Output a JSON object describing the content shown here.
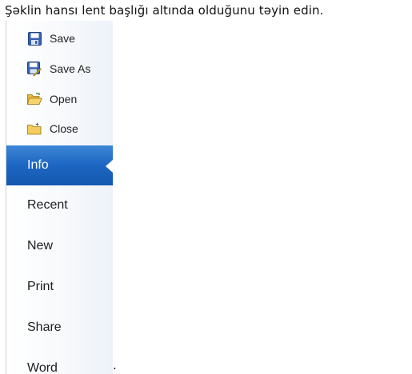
{
  "question": "Şəklin hansı lent başlığı altında olduğunu təyin edin.",
  "menu": {
    "commands": [
      {
        "label": "Save",
        "icon": "floppy-disk-icon"
      },
      {
        "label": "Save As",
        "icon": "save-as-icon"
      },
      {
        "label": "Open",
        "icon": "open-folder-icon"
      },
      {
        "label": "Close",
        "icon": "close-folder-icon"
      }
    ],
    "tabs": [
      {
        "label": "Info",
        "selected": true
      },
      {
        "label": "Recent"
      },
      {
        "label": "New"
      },
      {
        "label": "Print"
      },
      {
        "label": "Share"
      },
      {
        "label": "Word"
      }
    ]
  },
  "trailing_text": ".",
  "colors": {
    "selected_tab": "#1d66c2",
    "selected_text": "#ffffff",
    "menu_border": "#c9d3e0"
  }
}
